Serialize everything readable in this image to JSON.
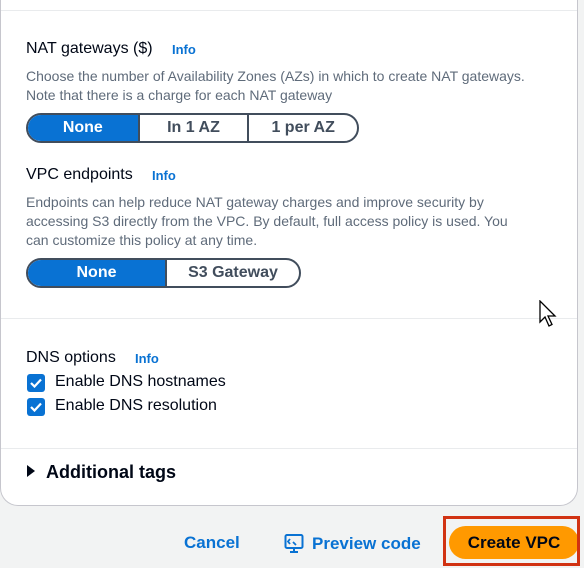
{
  "nat": {
    "label": "NAT gateways ($)",
    "info": "Info",
    "description_line1": "Choose the number of Availability Zones (AZs) in which to create NAT gateways.",
    "description_line2": "Note that there is a charge for each NAT gateway",
    "options": [
      "None",
      "In 1 AZ",
      "1 per AZ"
    ],
    "selected": "None"
  },
  "endpoints": {
    "label": "VPC endpoints",
    "info": "Info",
    "description_line1": "Endpoints can help reduce NAT gateway charges and improve security by",
    "description_line2": "accessing S3 directly from the VPC. By default, full access policy is used. You",
    "description_line3": "can customize this policy at any time.",
    "options": [
      "None",
      "S3 Gateway"
    ],
    "selected": "None"
  },
  "dns": {
    "label": "DNS options",
    "info": "Info",
    "hostnames": {
      "label": "Enable DNS hostnames",
      "checked": true
    },
    "resolution": {
      "label": "Enable DNS resolution",
      "checked": true
    }
  },
  "tags": {
    "label": "Additional tags"
  },
  "footer": {
    "cancel": "Cancel",
    "preview": "Preview code",
    "create": "Create VPC"
  },
  "colors": {
    "accent": "#0972d3",
    "primary": "#ff9900",
    "highlight": "#d13212"
  }
}
